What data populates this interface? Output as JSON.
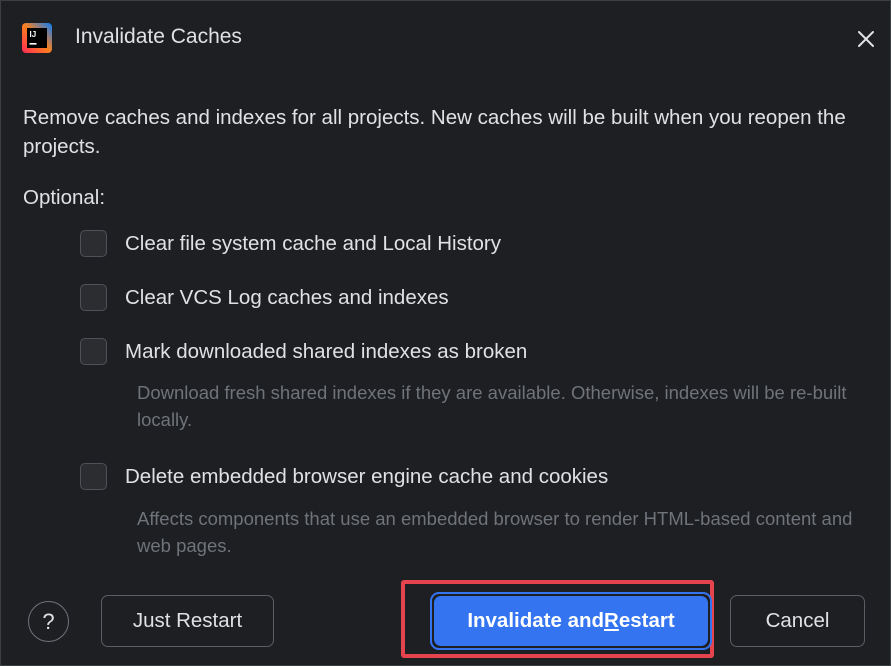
{
  "dialog": {
    "title": "Invalidate Caches",
    "logo_icon": "intellij-idea-icon",
    "close_icon": "close-icon",
    "description": "Remove caches and indexes for all projects. New caches will be built when you reopen the projects.",
    "optional_label": "Optional:",
    "options": [
      {
        "label": "Clear file system cache and Local History",
        "checked": false,
        "hint": ""
      },
      {
        "label": "Clear VCS Log caches and indexes",
        "checked": false,
        "hint": ""
      },
      {
        "label": "Mark downloaded shared indexes as broken",
        "checked": false,
        "hint": "Download fresh shared indexes if they are available. Otherwise, indexes will be re-built locally."
      },
      {
        "label": "Delete embedded browser engine cache and cookies",
        "checked": false,
        "hint": "Affects components that use an embedded browser to render HTML-based content and web pages."
      }
    ]
  },
  "footer": {
    "help_label": "?",
    "just_restart_label": "Just Restart",
    "primary_before": "Invalidate and ",
    "primary_mnemonic": "R",
    "primary_after": "estart",
    "cancel_label": "Cancel"
  },
  "colors": {
    "background": "#1e1f22",
    "primary": "#3574f0",
    "highlight": "#e5434e",
    "text": "#dfe1e5",
    "hint_text": "#6f737a"
  }
}
